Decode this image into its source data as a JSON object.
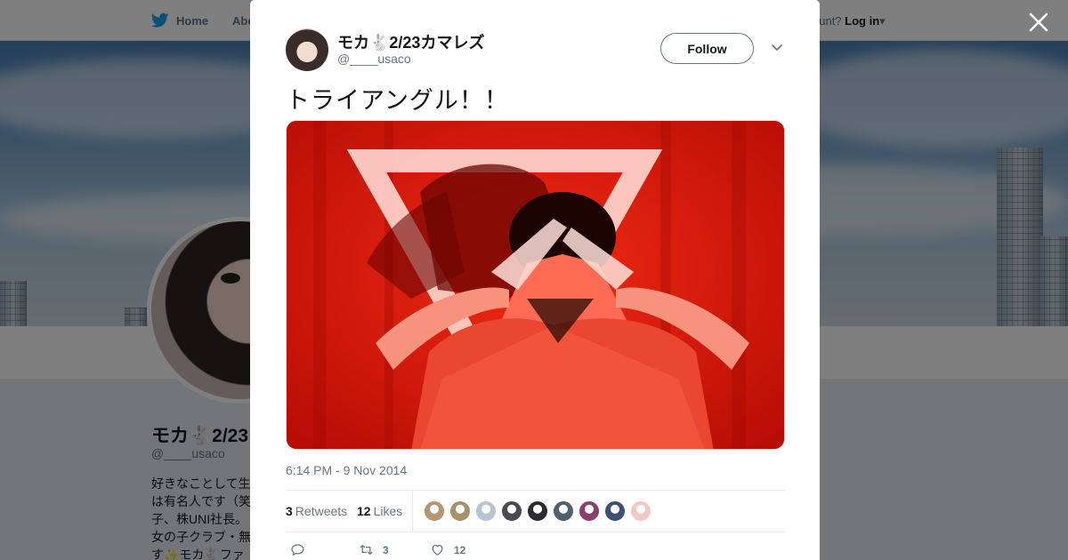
{
  "nav": {
    "home_label": "Home",
    "about_label": "Abo",
    "account_prompt": "ccount?",
    "login_label": "Log in"
  },
  "profile": {
    "name": "モカ🐇2/23",
    "handle": "@____usaco",
    "bio_lines": [
      "好きなことして生",
      "は有名人です（笑",
      "子、株UNI社長。",
      "女の子クラブ・無",
      "す✨モカ🐇ファ"
    ]
  },
  "tweet": {
    "author_name": "モカ🐇2/23カマレズ",
    "author_handle": "@____usaco",
    "follow_label": "Follow",
    "text": "トライアングル！！",
    "timestamp": "6:14 PM - 9 Nov 2014",
    "retweet_count": "3",
    "retweet_label": "Retweets",
    "like_count": "12",
    "like_label": "Likes",
    "reply_count": "",
    "action_retweet_count": "3",
    "action_like_count": "12"
  },
  "likers": [
    {
      "icon": "liker-avatar-1",
      "color": "#b59672"
    },
    {
      "icon": "liker-avatar-2",
      "color": "#a9926a"
    },
    {
      "icon": "liker-avatar-3",
      "color": "#b8c4cf"
    },
    {
      "icon": "liker-avatar-4",
      "color": "#4a4a52"
    },
    {
      "icon": "liker-avatar-5",
      "color": "#2d2a31"
    },
    {
      "icon": "liker-avatar-6",
      "color": "#52606b"
    },
    {
      "icon": "liker-avatar-7",
      "color": "#8a3f6c"
    },
    {
      "icon": "liker-avatar-8",
      "color": "#3d4f75"
    },
    {
      "icon": "liker-avatar-9",
      "color": "#f0c8c4"
    }
  ],
  "colors": {
    "accent": "#1da1f2",
    "text_primary": "#14171a",
    "text_secondary": "#657786",
    "photo_red": "#d8180b"
  }
}
